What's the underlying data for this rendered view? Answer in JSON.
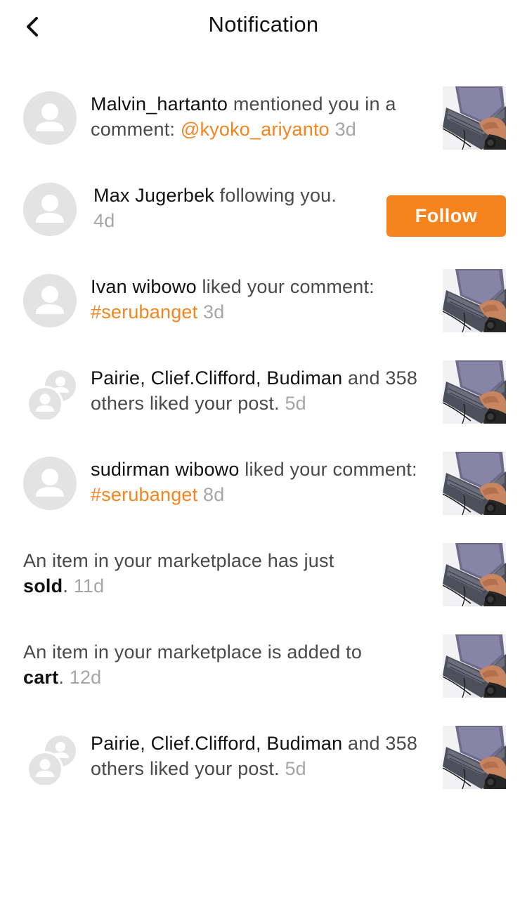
{
  "header": {
    "title": "Notification",
    "back_icon": "chevron-left-icon"
  },
  "colors": {
    "accent": "#f5841f",
    "name_text": "#111111",
    "body_text": "#4a4a4a",
    "time_text": "#a6a6a6",
    "avatar_bg": "#e3e3e3"
  },
  "notifications": [
    {
      "avatar": "avatar-icon",
      "name": "Malvin_hartanto",
      "text1": " mentioned you in a comment: ",
      "highlight": "@kyoko_ariyanto",
      "time": "3d",
      "thumb": "laptop-photo-thumbnail"
    },
    {
      "avatar": "avatar-icon",
      "name": "Max Jugerbek",
      "text1": " following you. ",
      "time": "4d",
      "follow_label": "Follow"
    },
    {
      "avatar": "avatar-icon",
      "name": "Ivan wibowo",
      "text1": " liked your comment: ",
      "highlight": "#serubanget",
      "time": "3d",
      "thumb": "laptop-photo-thumbnail"
    },
    {
      "avatar": "group-avatar-icon",
      "name": "Pairie, Clief.Clifford, Budiman",
      "text1": " and 358 others liked your post. ",
      "time": "5d",
      "thumb": "laptop-photo-thumbnail"
    },
    {
      "avatar": "avatar-icon",
      "name": "sudirman wibowo",
      "text1": " liked your comment: ",
      "highlight": "#serubanget",
      "time": "8d",
      "thumb": "laptop-photo-thumbnail"
    },
    {
      "text1": "An item in your marketplace has just ",
      "bold": "sold",
      "text2": ". ",
      "time": "11d",
      "thumb": "laptop-photo-thumbnail"
    },
    {
      "text1": "An item in your marketplace is added to ",
      "bold": "cart",
      "text2": ". ",
      "time": "12d",
      "thumb": "laptop-photo-thumbnail"
    },
    {
      "avatar": "group-avatar-icon",
      "name": "Pairie, Clief.Clifford, Budiman",
      "text1": " and 358 others liked your post. ",
      "time": "5d",
      "thumb": "laptop-photo-thumbnail"
    }
  ]
}
